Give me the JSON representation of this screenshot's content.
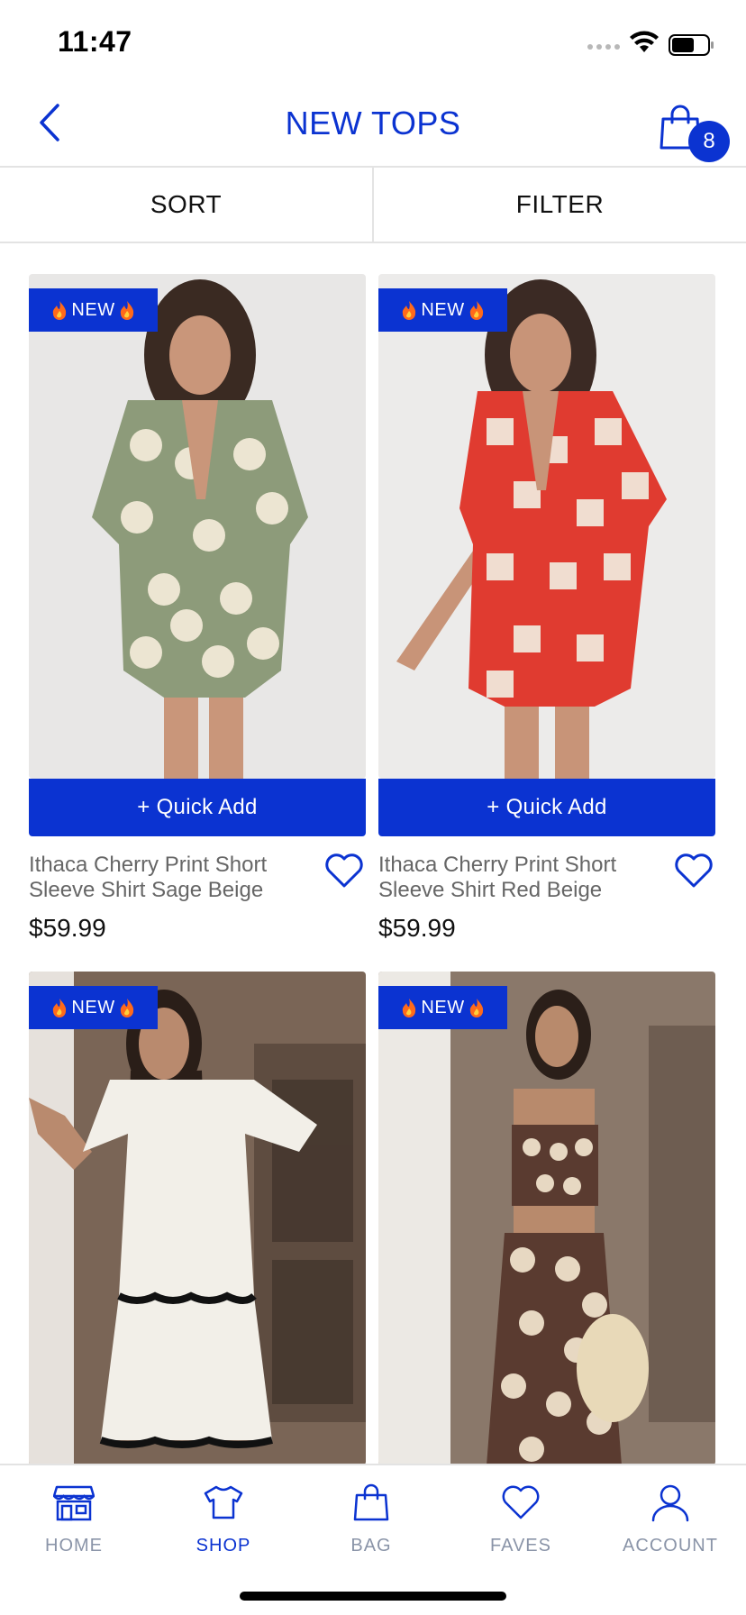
{
  "status_bar": {
    "time": "11:47"
  },
  "header": {
    "title": "NEW TOPS",
    "back_icon": "chevron-left-icon",
    "bag_icon": "shopping-bag-icon",
    "bag_count": "8"
  },
  "controls": {
    "sort_label": "SORT",
    "filter_label": "FILTER"
  },
  "products": [
    {
      "badge": "NEW",
      "quick_add": "+ Quick Add",
      "name": "Ithaca Cherry Print Short Sleeve Shirt Sage Beige",
      "price": "$59.99"
    },
    {
      "badge": "NEW",
      "quick_add": "+ Quick Add",
      "name": "Ithaca Cherry Print Short Sleeve Shirt Red Beige",
      "price": "$59.99"
    },
    {
      "badge": "NEW"
    },
    {
      "badge": "NEW"
    }
  ],
  "tab_bar": {
    "items": [
      {
        "label": "HOME",
        "icon": "storefront-icon"
      },
      {
        "label": "SHOP",
        "icon": "tshirt-icon",
        "active": true
      },
      {
        "label": "BAG",
        "icon": "shopping-bag-icon"
      },
      {
        "label": "FAVES",
        "icon": "heart-icon"
      },
      {
        "label": "ACCOUNT",
        "icon": "user-icon"
      }
    ]
  },
  "colors": {
    "accent": "#0b33d1",
    "muted_text": "#666666",
    "tab_inactive": "#8a94a8"
  }
}
